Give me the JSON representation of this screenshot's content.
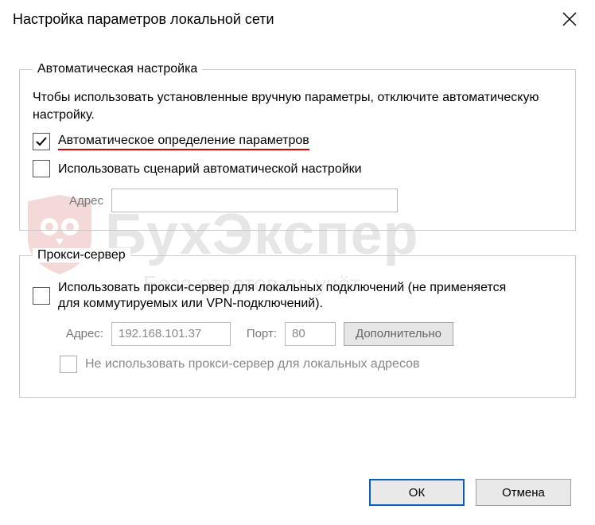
{
  "window": {
    "title": "Настройка параметров локальной сети"
  },
  "auto": {
    "legend": "Автоматическая настройка",
    "desc": "Чтобы использовать установленные вручную параметры, отключите автоматическую настройку.",
    "detect_label": "Автоматическое определение параметров",
    "detect_checked": true,
    "script_label": "Использовать сценарий автоматической настройки",
    "script_checked": false,
    "addr_label": "Адрес",
    "addr_value": ""
  },
  "proxy": {
    "legend": "Прокси-сервер",
    "use_label": "Использовать прокси-сервер для локальных подключений (не применяется для коммутируемых или VPN-подключений).",
    "use_checked": false,
    "addr_label": "Адрес:",
    "addr_value": "192.168.101.37",
    "port_label": "Порт:",
    "port_value": "80",
    "advanced_label": "Дополнительно",
    "bypass_label": "Не использовать прокси-сервер для локальных адресов",
    "bypass_checked": false
  },
  "footer": {
    "ok": "ОК",
    "cancel": "Отмена"
  },
  "watermark": {
    "title": "БухЭкспер",
    "subtitle": "База ответов по учёт"
  }
}
